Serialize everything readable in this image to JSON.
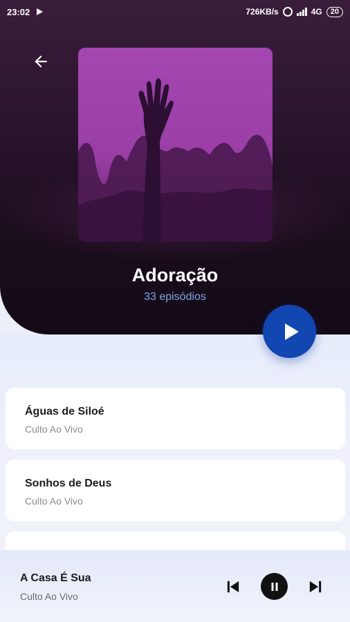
{
  "status_bar": {
    "time": "23:02",
    "network_speed": "726KB/s",
    "network_type": "4G",
    "battery": "20"
  },
  "header": {
    "back_icon": "arrow-left-icon",
    "cover_description_icon": "raised-hand-worship-image",
    "title": "Adoração",
    "episode_count": "33 episódios",
    "colors": {
      "accent": "#1246B0",
      "subtitle": "#7FA8E6",
      "header_bg": "#1a0d1c"
    }
  },
  "episodes": [
    {
      "title": "Águas de Siloé",
      "subtitle": "Culto Ao Vivo"
    },
    {
      "title": "Sonhos de Deus",
      "subtitle": "Culto Ao Vivo"
    }
  ],
  "mini_player": {
    "title": "A Casa É Sua",
    "subtitle": "Culto Ao Vivo",
    "controls": [
      "skip-previous-icon",
      "pause-icon",
      "skip-next-icon"
    ]
  }
}
